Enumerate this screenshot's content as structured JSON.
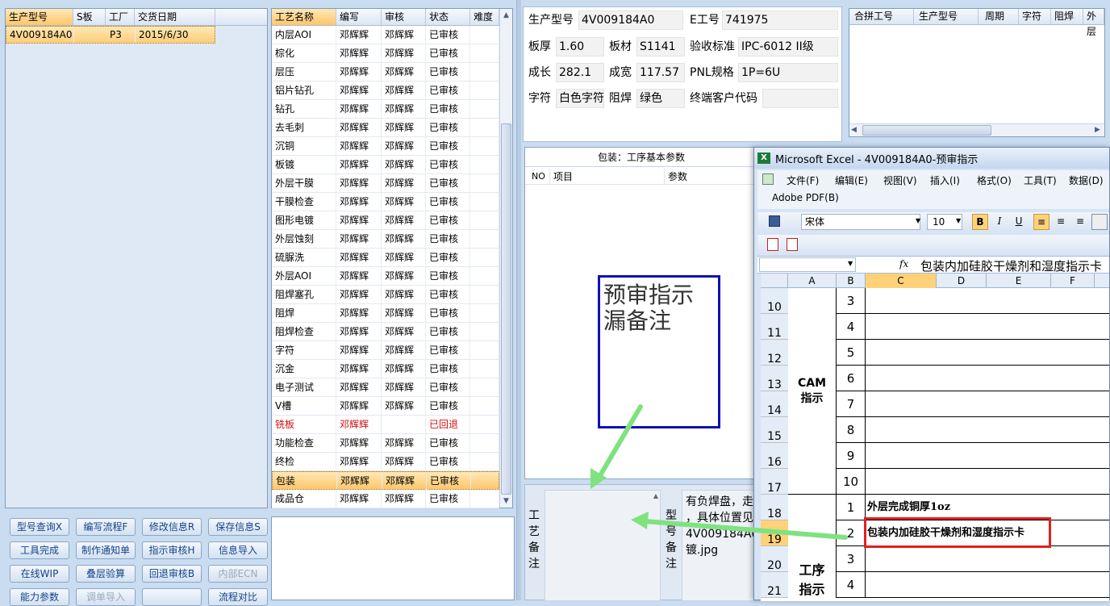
{
  "product_list": {
    "columns": [
      "生产型号",
      "S板",
      "工厂",
      "交货日期"
    ],
    "rows": [
      [
        "4V009184A0",
        "",
        "P3",
        "2015/6/30"
      ]
    ]
  },
  "process_list": {
    "columns": [
      "工艺名称",
      "编写",
      "审核",
      "状态",
      "难度"
    ],
    "rows": [
      [
        "内层AOI",
        "邓辉辉",
        "邓辉辉",
        "已审核",
        ""
      ],
      [
        "棕化",
        "邓辉辉",
        "邓辉辉",
        "已审核",
        ""
      ],
      [
        "层压",
        "邓辉辉",
        "邓辉辉",
        "已审核",
        ""
      ],
      [
        "铝片钻孔",
        "邓辉辉",
        "邓辉辉",
        "已审核",
        ""
      ],
      [
        "钻孔",
        "邓辉辉",
        "邓辉辉",
        "已审核",
        ""
      ],
      [
        "去毛刺",
        "邓辉辉",
        "邓辉辉",
        "已审核",
        ""
      ],
      [
        "沉铜",
        "邓辉辉",
        "邓辉辉",
        "已审核",
        ""
      ],
      [
        "板镀",
        "邓辉辉",
        "邓辉辉",
        "已审核",
        ""
      ],
      [
        "外层干膜",
        "邓辉辉",
        "邓辉辉",
        "已审核",
        ""
      ],
      [
        "干膜检查",
        "邓辉辉",
        "邓辉辉",
        "已审核",
        ""
      ],
      [
        "图形电镀",
        "邓辉辉",
        "邓辉辉",
        "已审核",
        ""
      ],
      [
        "外层蚀刻",
        "邓辉辉",
        "邓辉辉",
        "已审核",
        ""
      ],
      [
        "硫脲洗",
        "邓辉辉",
        "邓辉辉",
        "已审核",
        ""
      ],
      [
        "外层AOI",
        "邓辉辉",
        "邓辉辉",
        "已审核",
        ""
      ],
      [
        "阻焊塞孔",
        "邓辉辉",
        "邓辉辉",
        "已审核",
        ""
      ],
      [
        "阻焊",
        "邓辉辉",
        "邓辉辉",
        "已审核",
        ""
      ],
      [
        "阻焊检查",
        "邓辉辉",
        "邓辉辉",
        "已审核",
        ""
      ],
      [
        "字符",
        "邓辉辉",
        "邓辉辉",
        "已审核",
        ""
      ],
      [
        "沉金",
        "邓辉辉",
        "邓辉辉",
        "已审核",
        ""
      ],
      [
        "电子测试",
        "邓辉辉",
        "邓辉辉",
        "已审核",
        ""
      ],
      [
        "V槽",
        "邓辉辉",
        "邓辉辉",
        "已审核",
        ""
      ],
      [
        "铣板",
        "邓辉辉",
        "",
        "已回退",
        ""
      ],
      [
        "功能检查",
        "邓辉辉",
        "邓辉辉",
        "已审核",
        ""
      ],
      [
        "终检",
        "邓辉辉",
        "邓辉辉",
        "已审核",
        ""
      ],
      [
        "包装",
        "邓辉辉",
        "邓辉辉",
        "已审核",
        ""
      ],
      [
        "成品仓",
        "邓辉辉",
        "邓辉辉",
        "已审核",
        ""
      ]
    ],
    "returned_row": 21,
    "selected_row": 24
  },
  "buttons": [
    [
      "型号查询X",
      "编写流程F",
      "修改信息R",
      "保存信息S"
    ],
    [
      "工具完成",
      "制作通知单",
      "指示审核H",
      "信息导入"
    ],
    [
      "在线WIP",
      "叠层验算",
      "回退审核B",
      "内部ECN"
    ],
    [
      "能力参数",
      "调单导入",
      "",
      "流程对比"
    ]
  ],
  "info": {
    "product_label": "生产型号",
    "product": "4V009184A0",
    "eno_label": "E工号",
    "eno": "741975",
    "thickness_label": "板厚",
    "thickness": "1.60",
    "material_label": "板材",
    "material": "S1141",
    "standard_label": "验收标准",
    "standard": "IPC-6012 II级",
    "length_label": "成长",
    "length": "282.1",
    "width_label": "成宽",
    "width": "117.57",
    "pnl_label": "PNL规格",
    "pnl": "1P=6U",
    "char_label": "字符",
    "char": "白色字符",
    "mask_label": "阻焊",
    "mask": "绿色",
    "customer_label": "终端客户代码",
    "customer": ""
  },
  "merge_grid": {
    "columns": [
      "合拼工号",
      "生产型号",
      "周期",
      "字符",
      "阻焊",
      "外层"
    ]
  },
  "param_panel": {
    "title": "包装：工序基本参数",
    "columns": [
      "NO",
      "项目",
      "参数"
    ]
  },
  "note_box": "预审指示漏备注",
  "process_note": {
    "label": "工艺备注",
    "model_label": "型号备注",
    "text": "有负焊盘，走\n，具体位置见\n4V009184A0\n镀.jpg"
  },
  "excel": {
    "title": "Microsoft Excel - 4V009184A0-预审指示",
    "menu": [
      "文件(F)",
      "编辑(E)",
      "视图(V)",
      "插入(I)",
      "格式(O)",
      "工具(T)",
      "数据(D)",
      "窗"
    ],
    "adobe": "Adobe PDF(B)",
    "font": "宋体",
    "size": "10",
    "formula": "包装内加硅胶干燥剂和湿度指示卡",
    "col_headers": [
      "A",
      "B",
      "C",
      "D",
      "E",
      "F"
    ],
    "row_numbers": [
      "10",
      "11",
      "12",
      "13",
      "14",
      "15",
      "16",
      "17",
      "18",
      "19",
      "20",
      "21"
    ],
    "cam_label": "CAM指示",
    "cam_b": [
      "3",
      "4",
      "5",
      "6",
      "7",
      "8",
      "9",
      "10"
    ],
    "proc_label": "工序指示",
    "proc_b": [
      "1",
      "2",
      "3",
      "4"
    ],
    "row18_text": "外层完成铜厚1oz",
    "row19_text": "包装内加硅胶干燥剂和湿度指示卡"
  },
  "colors": {
    "accent": "#ffc66a",
    "arrow": "#7fe27f",
    "highlight_box": "#e02020",
    "returned": "#d01010"
  }
}
